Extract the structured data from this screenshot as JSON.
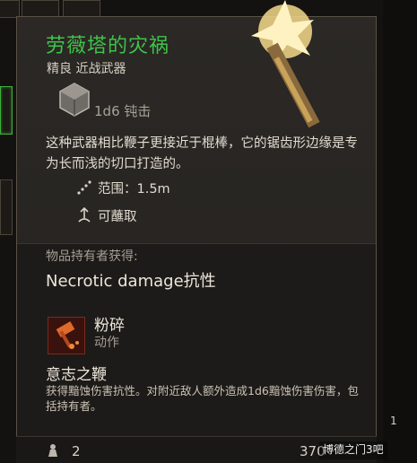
{
  "item": {
    "name": "劳薇塔的灾祸",
    "rarity_type": "精良 近战武器",
    "damage": "1d6 钝击",
    "description": "这种武器相比鞭子更接近于棍棒，它的锯齿形边缘是专为长而浅的切口打造的。",
    "properties": [
      {
        "icon": "range-icon",
        "label": "范围：1.5m"
      },
      {
        "icon": "dippable-icon",
        "label": "可蘸取"
      }
    ],
    "owner_heading": "物品持有者获得:",
    "owner_effect": "Necrotic damage抗性",
    "action": {
      "name": "粉碎",
      "type": "动作"
    },
    "passive": {
      "name": "意志之鞭",
      "description": "获得黯蚀伤害抗性。对附近敌人额外造成1d6黯蚀伤害伤害，包括持有者。"
    },
    "weight": "2",
    "price": "370"
  },
  "side_counter": "1",
  "watermark": "博德之门3吧",
  "colors": {
    "rarity_green": "#3fc34a",
    "panel": "#2b2825"
  }
}
